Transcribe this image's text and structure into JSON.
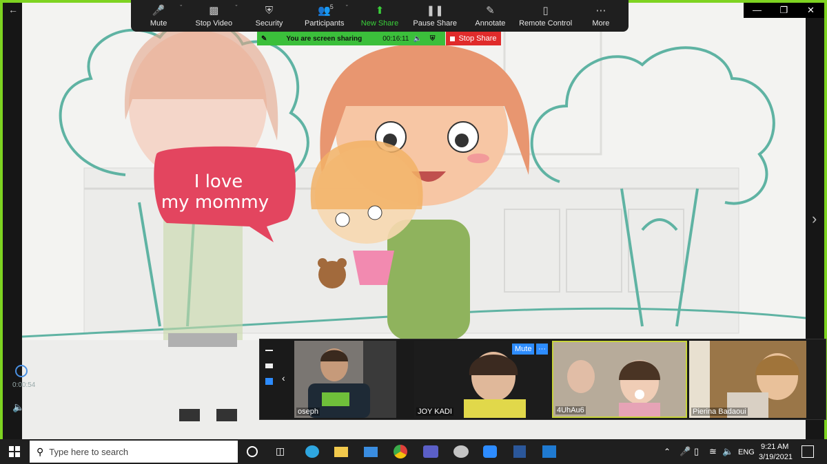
{
  "toolbar": {
    "items": [
      {
        "label": "Mute",
        "icon": "microphone-icon"
      },
      {
        "label": "Stop Video",
        "icon": "video-camera-icon"
      },
      {
        "label": "Security",
        "icon": "shield-icon"
      },
      {
        "label": "Participants",
        "icon": "participants-icon",
        "count": "5"
      },
      {
        "label": "New Share",
        "icon": "share-up-arrow-icon"
      },
      {
        "label": "Pause Share",
        "icon": "pause-icon"
      },
      {
        "label": "Annotate",
        "icon": "pen-icon"
      },
      {
        "label": "Remote Control",
        "icon": "mouse-icon"
      },
      {
        "label": "More",
        "icon": "more-dots-icon"
      }
    ]
  },
  "share_banner": {
    "text": "You are screen sharing",
    "timer": "00:16:11"
  },
  "stop_share": {
    "label": "Stop Share"
  },
  "content": {
    "speech_line1": "I love",
    "speech_line2": "my mommy"
  },
  "player": {
    "time": "0:00:54"
  },
  "gallery": {
    "tiles": [
      {
        "name": "oseph"
      },
      {
        "name": "JOY KADI",
        "mute_label": "Mute",
        "more_label": "···"
      },
      {
        "name": "4UhAu6"
      },
      {
        "name": "Pierina  Badaoui"
      }
    ]
  },
  "taskbar": {
    "search_placeholder": "Type here to search",
    "language": "ENG",
    "time": "9:21 AM",
    "date": "3/19/2021"
  },
  "colors": {
    "share_green": "#3bbf3b",
    "stop_red": "#e02b2b",
    "border_green": "#7ed321"
  }
}
